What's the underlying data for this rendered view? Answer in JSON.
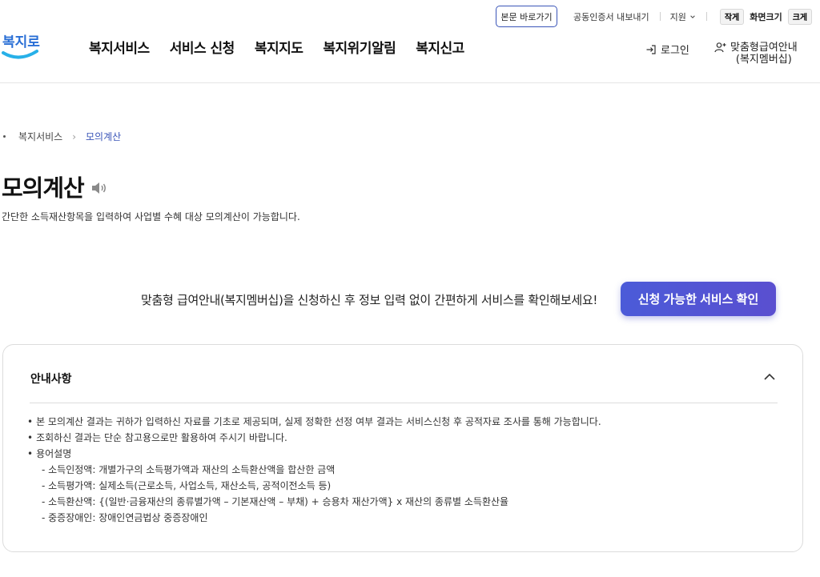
{
  "utility": {
    "skip_link": "본문 바로가기",
    "cert_export": "공동인증서 내보내기",
    "support": "지원",
    "font_small": "작게",
    "font_size_label": "화면크기",
    "font_large": "크게"
  },
  "logo": {
    "text": "복지로",
    "icon": "bokjiro-logo"
  },
  "nav": {
    "items": [
      "복지서비스",
      "서비스 신청",
      "복지지도",
      "복지위기알림",
      "복지신고"
    ]
  },
  "header_actions": {
    "login": "로그인",
    "membership_line1": "맞춤형급여안내",
    "membership_line2": "(복지멤버십)"
  },
  "breadcrumb": {
    "parent": "복지서비스",
    "current": "모의계산"
  },
  "page": {
    "title": "모의계산",
    "subtitle": "간단한 소득재산항목을 입력하여 사업별 수혜 대상 모의계산이 가능합니다."
  },
  "promo": {
    "text": "맞춤형 급여안내(복지멤버십)을 신청하신 후 정보 입력 없이 간편하게 서비스를 확인해보세요!",
    "button": "신청 가능한 서비스 확인"
  },
  "notice": {
    "heading": "안내사항",
    "items": [
      "본 모의계산 결과는 귀하가 입력하신 자료를 기초로 제공되며, 실제 정확한 선정 여부 결과는 서비스신청 후 공적자료 조사를 통해 가능합니다.",
      "조회하신 결과는 단순 참고용으로만 활용하여 주시기 바랍니다.",
      "용어설명"
    ],
    "terms": [
      "- 소득인정액: 개별가구의 소득평가액과 재산의 소득환산액을 합산한 금액",
      "- 소득평가액: 실제소득(근로소득, 사업소득, 재산소득, 공적이전소득 등)",
      "- 소득환산액: {(일반·금융재산의 종류별가액 – 기본재산액 – 부채) + 승용차 재산가액} x 재산의 종류별 소득환산율",
      "- 중증장애인: 장애인연금법상 중증장애인"
    ]
  },
  "colors": {
    "accent": "#3a55b8",
    "button_gradient_start": "#4b5bd8",
    "button_gradient_end": "#5a4fd0"
  }
}
